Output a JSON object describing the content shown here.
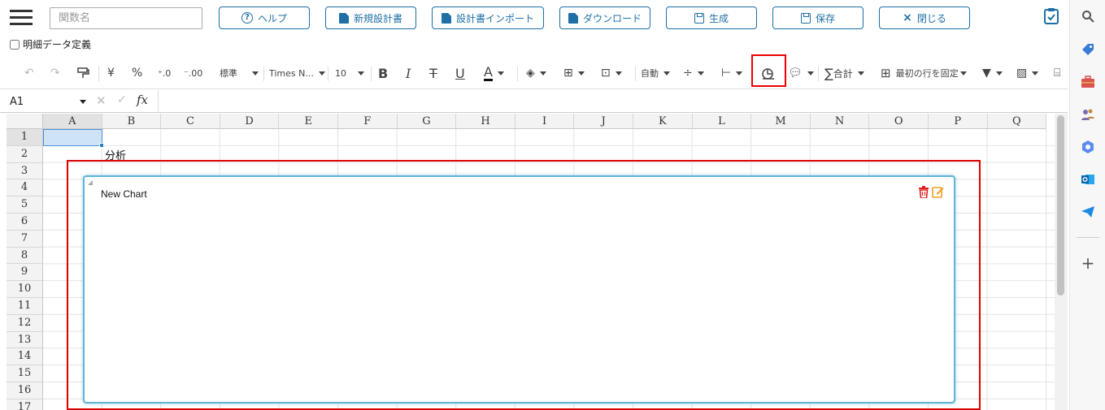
{
  "header": {
    "search_placeholder": "関数名",
    "buttons": [
      {
        "label": "ヘルプ",
        "icon": "help-circle-icon"
      },
      {
        "label": "新規設計書",
        "icon": "file-plus-icon"
      },
      {
        "label": "設計書インポート",
        "icon": "file-import-icon"
      },
      {
        "label": "ダウンロード",
        "icon": "file-download-icon"
      },
      {
        "label": "生成",
        "icon": "floppy-icon"
      },
      {
        "label": "保存",
        "icon": "floppy-icon"
      },
      {
        "label": "閉じる",
        "icon": "close-icon"
      }
    ],
    "detail_checkbox_label": "明細データ定義",
    "detail_checkbox_checked": false
  },
  "toolbar": {
    "currency": "¥",
    "percent": "%",
    "format_style": "標準",
    "font_name": "Times N...",
    "font_size": "10",
    "bold": "B",
    "italic": "I",
    "underline": "U",
    "font_color_letter": "A",
    "wrap": "自動",
    "sum": "合計",
    "freeze": "最初の行を固定"
  },
  "formula_bar": {
    "cell_ref": "A1",
    "fx": "fx"
  },
  "sheet": {
    "columns": [
      "A",
      "B",
      "C",
      "D",
      "E",
      "F",
      "G",
      "H",
      "I",
      "J",
      "K",
      "L",
      "M",
      "N",
      "O",
      "P",
      "Q"
    ],
    "rows": [
      "1",
      "2",
      "3",
      "4",
      "5",
      "6",
      "7",
      "8",
      "9",
      "10",
      "11",
      "12",
      "13",
      "14",
      "15",
      "16",
      "17"
    ],
    "selected_cell": "A1",
    "cell_B2": "分析"
  },
  "chart": {
    "title": "New Chart"
  },
  "colors": {
    "accent": "#1d6fa5",
    "highlight": "#e00000",
    "chart_border": "#5fb4d8",
    "delete": "#e02020",
    "edit": "#f0a020"
  }
}
